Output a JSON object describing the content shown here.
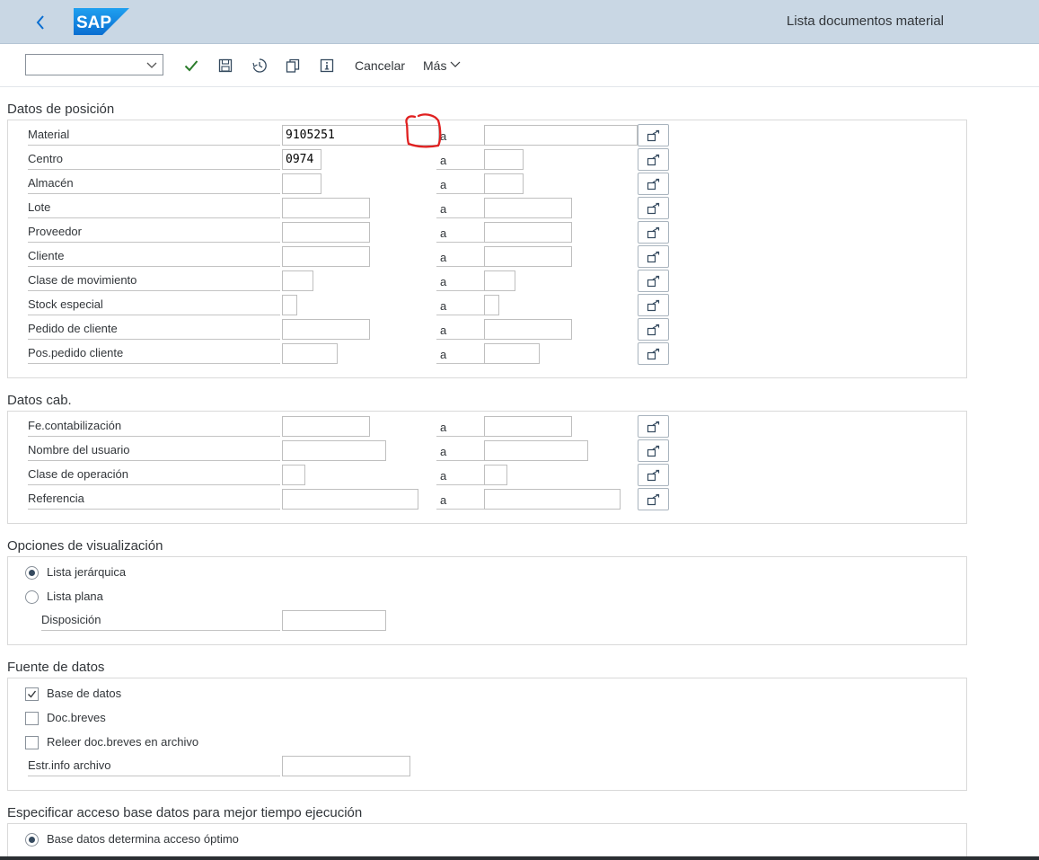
{
  "header": {
    "logo_text": "SAP",
    "title": "Lista documentos material",
    "colors": {
      "bar": "#c9d7e4",
      "logo": "#1a8ee0"
    }
  },
  "toolbar": {
    "variant_value": "",
    "actions": [
      {
        "name": "execute",
        "icon": "checkmark-icon"
      },
      {
        "name": "save-variant",
        "icon": "save-icon"
      },
      {
        "name": "get-variant",
        "icon": "clock-icon"
      },
      {
        "name": "copy",
        "icon": "copy-icon"
      },
      {
        "name": "info",
        "icon": "info-icon"
      }
    ],
    "cancel_label": "Cancelar",
    "more_label": "Más"
  },
  "range_separator": "a",
  "sections": {
    "item_data": {
      "title": "Datos de posición",
      "rows": [
        {
          "label": "Material",
          "from": "9105251",
          "to": ""
        },
        {
          "label": "Centro",
          "from": "0974",
          "to": ""
        },
        {
          "label": "Almacén",
          "from": "",
          "to": ""
        },
        {
          "label": "Lote",
          "from": "",
          "to": ""
        },
        {
          "label": "Proveedor",
          "from": "",
          "to": ""
        },
        {
          "label": "Cliente",
          "from": "",
          "to": ""
        },
        {
          "label": "Clase de movimiento",
          "from": "",
          "to": ""
        },
        {
          "label": "Stock especial",
          "from": "",
          "to": ""
        },
        {
          "label": "Pedido de cliente",
          "from": "",
          "to": ""
        },
        {
          "label": "Pos.pedido cliente",
          "from": "",
          "to": ""
        }
      ]
    },
    "header_data": {
      "title": "Datos cab.",
      "rows": [
        {
          "label": "Fe.contabilización",
          "from": "",
          "to": ""
        },
        {
          "label": "Nombre del usuario",
          "from": "",
          "to": ""
        },
        {
          "label": "Clase de operación",
          "from": "",
          "to": ""
        },
        {
          "label": "Referencia",
          "from": "",
          "to": ""
        }
      ]
    },
    "display_options": {
      "title": "Opciones de visualización",
      "radios": [
        {
          "label": "Lista jerárquica",
          "selected": true
        },
        {
          "label": "Lista plana",
          "selected": false
        }
      ],
      "layout_label": "Disposición",
      "layout_value": ""
    },
    "data_source": {
      "title": "Fuente de datos",
      "checks": [
        {
          "label": "Base de datos",
          "checked": true
        },
        {
          "label": "Doc.breves",
          "checked": false
        },
        {
          "label": "Releer doc.breves en archivo",
          "checked": false
        }
      ],
      "archive_label": "Estr.info archivo",
      "archive_value": ""
    },
    "db_access": {
      "title": "Especificar acceso base datos para mejor tiempo ejecución",
      "radios": [
        {
          "label": "Base datos determina acceso óptimo",
          "selected": true
        }
      ]
    }
  }
}
